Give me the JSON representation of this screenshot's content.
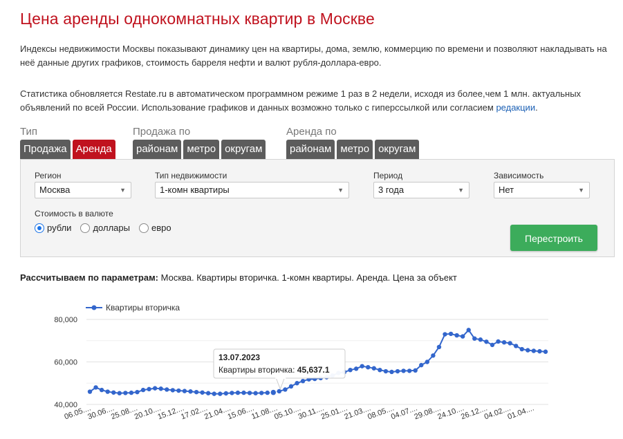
{
  "page": {
    "title": "Цена аренды однокомнатных квартир в Москве",
    "intro": "Индексы недвижимости Москвы показывают динамику цен на квартиры, дома, землю, коммерцию по времени и позволяют накладывать на неё данные других графиков, стоимость барреля нефти и валют рубля-доллара-евро.",
    "stats_text": "Статистика обновляется Restate.ru в автоматическом программном режиме 1 раз в 2 недели, исходя из более,чем 1 млн. актуальных объявлений по всей России. Использование графиков и данных возможно только с гиперссылкой или согласием ",
    "stats_link": "редакции",
    "stats_end": "."
  },
  "tabs": {
    "type": {
      "label": "Тип",
      "items": [
        "Продажа",
        "Аренда"
      ],
      "active": "Аренда"
    },
    "sale_by": {
      "label": "Продажа по",
      "items": [
        "районам",
        "метро",
        "округам"
      ]
    },
    "rent_by": {
      "label": "Аренда по",
      "items": [
        "районам",
        "метро",
        "округам"
      ]
    }
  },
  "form": {
    "region_label": "Регион",
    "region_value": "Москва",
    "type_label": "Тип недвижимости",
    "type_value": "1-комн квартиры",
    "period_label": "Период",
    "period_value": "3 года",
    "dependency_label": "Зависимость",
    "dependency_value": "Нет",
    "currency_label": "Стоимость в валюте",
    "currency_options": [
      "рубли",
      "доллары",
      "евро"
    ],
    "currency_selected": "рубли",
    "rebuild_button": "Перестроить"
  },
  "params": {
    "label": "Рассчитываем по параметрам:",
    "value": " Москва. Квартиры вторичка. 1-комн квартиры. Аренда. Цена за объект"
  },
  "colors": {
    "accent": "#c0121e",
    "tab_inactive": "#5c5c5c",
    "button": "#3cac5b",
    "series": "#3366cc",
    "link": "#1a5fb4"
  },
  "chart_data": {
    "type": "line",
    "series": [
      {
        "name": "Квартиры вторичка",
        "values": [
          46000,
          48000,
          46800,
          46000,
          45600,
          45300,
          45400,
          45500,
          45800,
          46800,
          47200,
          47600,
          47400,
          47000,
          46700,
          46500,
          46300,
          46100,
          45800,
          45600,
          45300,
          45000,
          45000,
          45200,
          45400,
          45500,
          45500,
          45400,
          45300,
          45400,
          45500,
          45637.1,
          46200,
          47000,
          48500,
          50000,
          51000,
          51800,
          52000,
          52400,
          52800,
          53600,
          54800,
          55200,
          56200,
          56800,
          58000,
          57500,
          57000,
          56200,
          55600,
          55300,
          55600,
          55800,
          55800,
          56000,
          58500,
          60000,
          63000,
          67000,
          73000,
          73200,
          72500,
          72000,
          75000,
          71000,
          70500,
          69500,
          68000,
          69600,
          69200,
          68800,
          67500,
          66000,
          65500,
          65200,
          65000,
          64800
        ]
      }
    ],
    "x_tick_labels": [
      "06.05....",
      "30.06....",
      "25.08....",
      "20.10....",
      "15.12....",
      "17.02....",
      "21.04....",
      "15.06....",
      "11.08....",
      "05.10....",
      "30.11....",
      "25.01....",
      "21.03....",
      "08.05....",
      "04.07....",
      "29.08....",
      "24.10....",
      "26.12....",
      "04.02....",
      "01.04...."
    ],
    "y_ticks": [
      40000,
      60000,
      80000
    ],
    "y_tick_labels": [
      "40,000",
      "60,000",
      "80,000"
    ],
    "ylim": [
      40000,
      80000
    ],
    "grid": true,
    "legend": "top-left",
    "tooltip": {
      "date": "13.07.2023",
      "label": "Квартиры вторичка:",
      "value": "45,637.1",
      "index": 31
    }
  }
}
